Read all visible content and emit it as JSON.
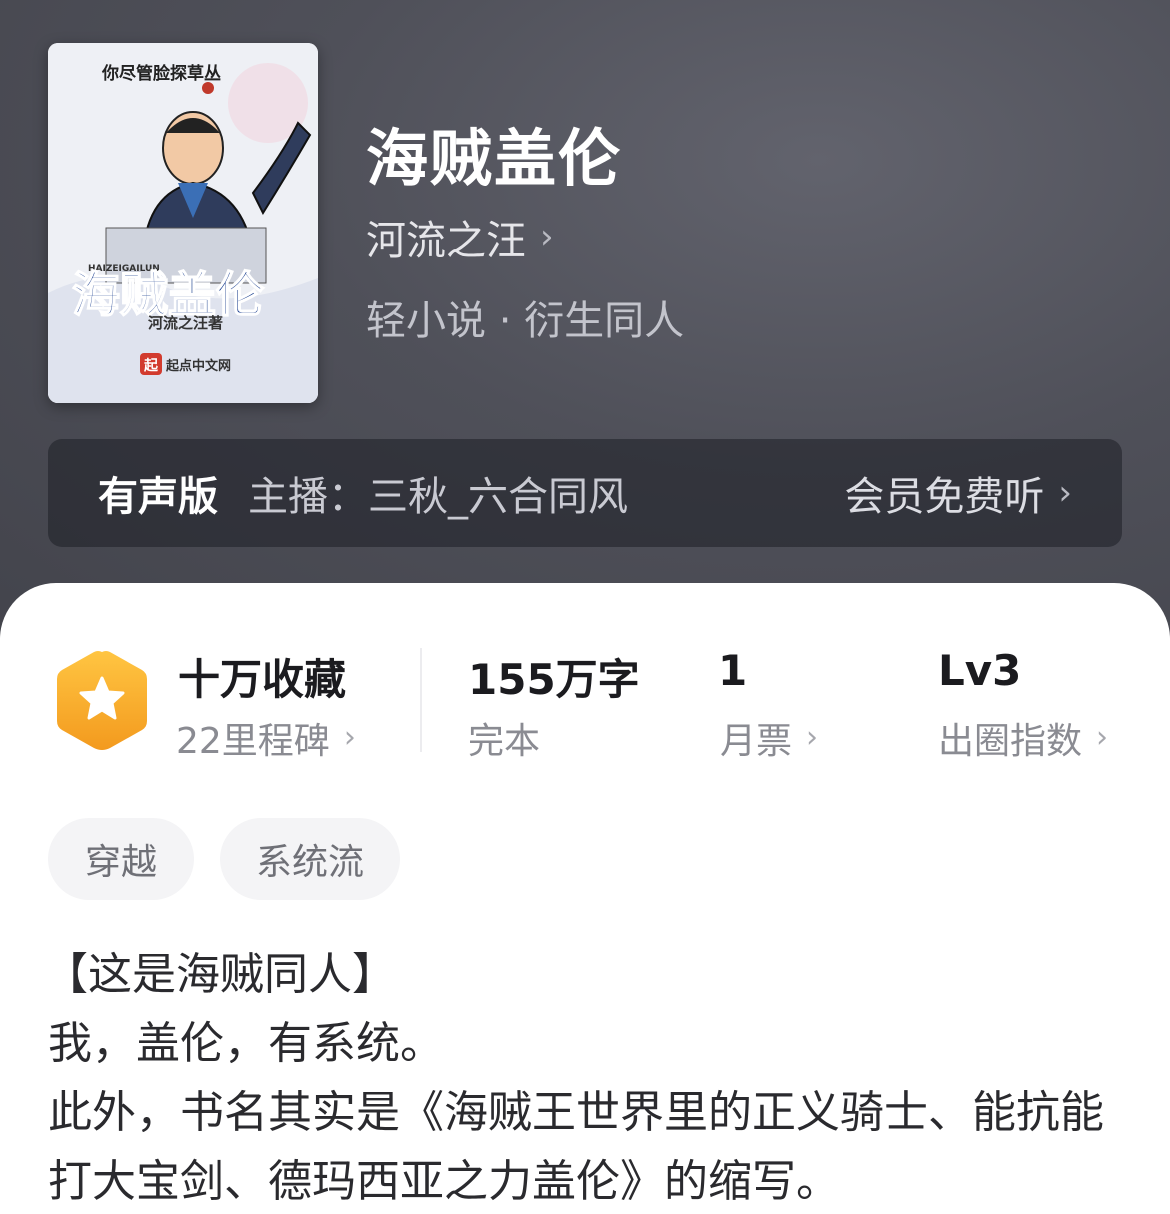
{
  "book": {
    "title": "海贼盖伦",
    "author": "河流之汪",
    "category": "轻小说 · 衍生同人",
    "cover": {
      "top_text": "你尽管脸探草丛",
      "pinyin": "HAIZEIGAILUN",
      "title_art": "海贼盖伦",
      "author_art": "河流之汪著",
      "publisher": "起点中文网",
      "publisher_mark": "起"
    }
  },
  "audio": {
    "label": "有声版",
    "host": "主播：三秋_六合同风",
    "cta": "会员免费听"
  },
  "stats": {
    "favorites": {
      "title": "十万收藏",
      "sub": "22里程碑"
    },
    "words": {
      "title": "155万字",
      "sub": "完本"
    },
    "monthly": {
      "title": "1",
      "sub": "月票"
    },
    "level": {
      "title": "Lv3",
      "sub": "出圈指数"
    }
  },
  "tags": [
    "穿越",
    "系统流"
  ],
  "synopsis": [
    "【这是海贼同人】",
    "我，盖伦，有系统。",
    "此外，书名其实是《海贼王世界里的正义骑士、能抗能打大宝剑、德玛西亚之力盖伦》的缩写。"
  ],
  "colors": {
    "header_bg": "#4f5059",
    "badge_orange": "#f5a623",
    "text_dark": "#1b1b1f",
    "text_muted": "#8a8b92"
  },
  "icons": {
    "chevron": "chevron-right-icon",
    "badge": "star-hexagon-icon"
  }
}
